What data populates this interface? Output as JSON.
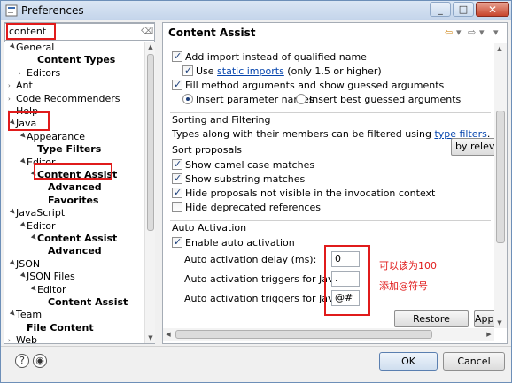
{
  "window": {
    "title": "Preferences"
  },
  "filter": {
    "value": "content"
  },
  "tree": [
    {
      "label": "General",
      "indent": 0,
      "toggle": "▲",
      "bold": false
    },
    {
      "label": "Content Types",
      "indent": 2,
      "toggle": "",
      "bold": true
    },
    {
      "label": "Editors",
      "indent": 1,
      "toggle": "›",
      "bold": false
    },
    {
      "label": "Ant",
      "indent": 0,
      "toggle": "›",
      "bold": false
    },
    {
      "label": "Code Recommenders",
      "indent": 0,
      "toggle": "›",
      "bold": false
    },
    {
      "label": "Help",
      "indent": 0,
      "toggle": "›",
      "bold": false
    },
    {
      "label": "Java",
      "indent": 0,
      "toggle": "▲",
      "bold": false
    },
    {
      "label": "Appearance",
      "indent": 1,
      "toggle": "▲",
      "bold": false
    },
    {
      "label": "Type Filters",
      "indent": 2,
      "toggle": "",
      "bold": true
    },
    {
      "label": "Editor",
      "indent": 1,
      "toggle": "▲",
      "bold": false
    },
    {
      "label": "Content Assist",
      "indent": 2,
      "toggle": "▲",
      "bold": true
    },
    {
      "label": "Advanced",
      "indent": 3,
      "toggle": "",
      "bold": true
    },
    {
      "label": "Favorites",
      "indent": 3,
      "toggle": "",
      "bold": true
    },
    {
      "label": "JavaScript",
      "indent": 0,
      "toggle": "▲",
      "bold": false
    },
    {
      "label": "Editor",
      "indent": 1,
      "toggle": "▲",
      "bold": false
    },
    {
      "label": "Content Assist",
      "indent": 2,
      "toggle": "▲",
      "bold": true
    },
    {
      "label": "Advanced",
      "indent": 3,
      "toggle": "",
      "bold": true
    },
    {
      "label": "JSON",
      "indent": 0,
      "toggle": "▲",
      "bold": false
    },
    {
      "label": "JSON Files",
      "indent": 1,
      "toggle": "▲",
      "bold": false
    },
    {
      "label": "Editor",
      "indent": 2,
      "toggle": "▲",
      "bold": false
    },
    {
      "label": "Content Assist",
      "indent": 3,
      "toggle": "",
      "bold": true
    },
    {
      "label": "Team",
      "indent": 0,
      "toggle": "▲",
      "bold": false
    },
    {
      "label": "File Content",
      "indent": 1,
      "toggle": "",
      "bold": true
    },
    {
      "label": "Web",
      "indent": 0,
      "toggle": "›",
      "bold": false
    }
  ],
  "page": {
    "title": "Content Assist",
    "nav": {
      "back": "⇦",
      "back_menu": "▾",
      "forward": "⇨",
      "forward_menu": "▾",
      "menu": "▾"
    },
    "opt_import": {
      "label": "Add import instead of qualified name",
      "checked": true
    },
    "opt_static_pre": "Use ",
    "opt_static_link": "static imports",
    "opt_static_post": " (only 1.5 or higher)",
    "opt_fill": {
      "label": "Fill method arguments and show guessed arguments",
      "checked": true
    },
    "radio_insert": "Insert parameter names",
    "radio_guess": "Insert best guessed arguments",
    "sorting_title": "Sorting and Filtering",
    "types_text": "Types along with their members can be filtered using ",
    "types_link": "type filters",
    "types_end": ".",
    "sort_label": "Sort proposals",
    "sort_value": "by relevance",
    "opt_camel": "Show camel case matches",
    "opt_substring": "Show substring matches",
    "opt_hide_invisible": "Hide proposals not visible in the invocation context",
    "opt_hide_deprecated": "Hide deprecated references",
    "auto_title": "Auto Activation",
    "opt_enable_auto": "Enable auto activation",
    "delay_label": "Auto activation delay (ms):",
    "delay_value": "0",
    "java_label": "Auto activation triggers for Java:",
    "java_value": ".",
    "javadoc_label": "Auto activation triggers for Javadoc:",
    "javadoc_value": "@#",
    "annot_delay": "可以该为100",
    "annot_java": "添加@符号",
    "restore_label": "Restore Defaults",
    "apply_label": "Apply"
  },
  "footer": {
    "ok": "OK",
    "cancel": "Cancel",
    "help_icon": "?"
  },
  "colors": {
    "annotation": "#e01b1b",
    "link": "#0645ad"
  }
}
